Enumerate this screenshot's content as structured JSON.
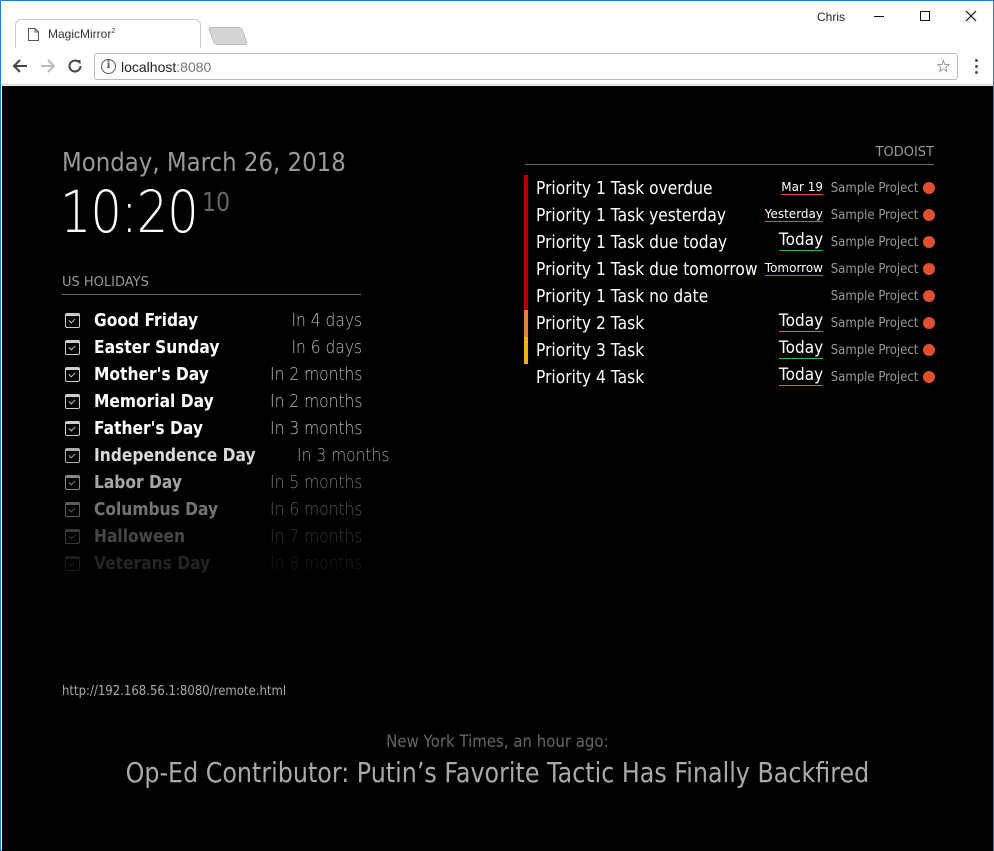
{
  "browser": {
    "tab_title": "MagicMirror",
    "tab_title_sup": "2",
    "user": "Chris",
    "url_host": "localhost",
    "url_port": ":8080"
  },
  "clock": {
    "date": "Monday, March 26, 2018",
    "time": "10:20",
    "seconds": "10"
  },
  "calendar": {
    "header": "US HOLIDAYS",
    "events": [
      {
        "title": "Good Friday",
        "time": "In 4 days",
        "opacity": 1.0
      },
      {
        "title": "Easter Sunday",
        "time": "In 6 days",
        "opacity": 1.0
      },
      {
        "title": "Mother's Day",
        "time": "In 2 months",
        "opacity": 1.0
      },
      {
        "title": "Memorial Day",
        "time": "In 2 months",
        "opacity": 1.0
      },
      {
        "title": "Father's Day",
        "time": "In 3 months",
        "opacity": 1.0
      },
      {
        "title": "Independence Day",
        "time": "In 3 months",
        "opacity": 0.85
      },
      {
        "title": "Labor Day",
        "time": "In 5 months",
        "opacity": 0.65
      },
      {
        "title": "Columbus Day",
        "time": "In 6 months",
        "opacity": 0.45
      },
      {
        "title": "Halloween",
        "time": "In 7 months",
        "opacity": 0.28
      },
      {
        "title": "Veterans Day",
        "time": "In 8 months",
        "opacity": 0.14
      }
    ]
  },
  "todoist": {
    "header": "TODOIST",
    "tasks": [
      {
        "title": "Priority 1 Task overdue",
        "due": "Mar 19",
        "due_style": "small",
        "due_color": "#e84545",
        "project": "Sample Project",
        "priority_color": "#b00000",
        "project_color": "#e05030"
      },
      {
        "title": "Priority 1 Task yesterday",
        "due": "Yesterday",
        "due_style": "small",
        "due_color": "#e84545",
        "project": "Sample Project",
        "priority_color": "#b00000",
        "project_color": "#e05030"
      },
      {
        "title": "Priority 1 Task due today",
        "due": "Today",
        "due_style": "big",
        "due_color": "#2bb84a",
        "project": "Sample Project",
        "priority_color": "#b00000",
        "project_color": "#e05030"
      },
      {
        "title": "Priority 1 Task due tomorrow",
        "due": "Tomorrow",
        "due_style": "small",
        "due_color": "#4a7be0",
        "project": "Sample Project",
        "priority_color": "#b00000",
        "project_color": "#e05030"
      },
      {
        "title": "Priority 1 Task no date",
        "due": "",
        "due_style": "small",
        "due_color": "",
        "project": "Sample Project",
        "priority_color": "#b00000",
        "project_color": "#e05030"
      },
      {
        "title": "Priority 2 Task",
        "due": "Today",
        "due_style": "big",
        "due_color": "#2bb84a",
        "project": "Sample Project",
        "priority_color": "#f08030",
        "project_color": "#e05030"
      },
      {
        "title": "Priority 3 Task",
        "due": "Today",
        "due_style": "big",
        "due_color": "#2bb84a",
        "project": "Sample Project",
        "priority_color": "#f0b020",
        "project_color": "#e05030"
      },
      {
        "title": "Priority 4 Task",
        "due": "Today",
        "due_style": "big",
        "due_color": "#2bb84a",
        "project": "Sample Project",
        "priority_color": "#000000",
        "project_color": "#e05030"
      }
    ]
  },
  "remote": {
    "url": "http://192.168.56.1:8080/remote.html"
  },
  "news": {
    "source": "New York Times, an hour ago:",
    "headline": "Op-Ed Contributor: Putin’s Favorite Tactic Has Finally Backfired"
  }
}
